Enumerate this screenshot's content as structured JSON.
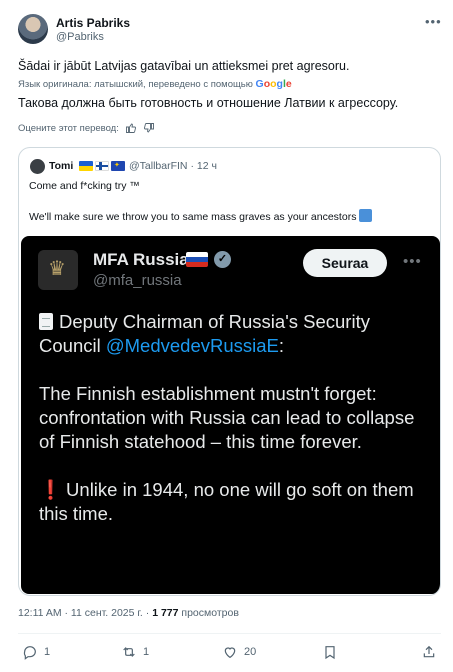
{
  "author": {
    "name": "Artis Pabriks",
    "handle": "@Pabriks"
  },
  "post": {
    "original_text": "Šādai ir jābūt Latvijas gatavībai un attieksmei pret agresoru.",
    "translated_by_prefix": "Язык оригинала: латышский, переведено с помощью",
    "translator_logo": "Google",
    "translated_text": "Такова должна быть готовность и отношение Латвии к агрессору.",
    "rate_translation": "Оцените этот перевод:"
  },
  "quote": {
    "name": "Tomi",
    "handle": "@TallbarFIN",
    "time": "12 ч",
    "separator": "·",
    "line1": "Come and f*cking try ™",
    "line2": "We'll make sure we throw you to same mass graves as your ancestors",
    "embed": {
      "name": "MFA Russia",
      "handle": "@mfa_russia",
      "follow_label": "Seuraa",
      "para1_text": "Deputy Chairman of Russia's Security Council ",
      "para1_link": "@MedvedevRussiaE",
      "para1_end": ":",
      "para2": "The Finnish establishment mustn't forget: confrontation with Russia can lead to collapse of Finnish statehood – this time forever.",
      "para3_mark": "❗",
      "para3": "Unlike in 1944, no one will go soft on them this time."
    }
  },
  "meta": {
    "time": "12:11 AM · 11 сент. 2025 г. · ",
    "views": "1 777",
    "views_label": " просмотров"
  },
  "actions": {
    "replies": "1",
    "reposts": "1",
    "likes": "20"
  },
  "colors": {
    "link": "#1d9bf0",
    "secondary_text": "#536471",
    "embed_background": "#000000"
  },
  "icons": [
    "more-icon",
    "thumbs-up-icon",
    "thumbs-down-icon",
    "verified-badge-icon",
    "reply-icon",
    "repost-icon",
    "like-icon",
    "bookmark-icon",
    "share-icon"
  ]
}
